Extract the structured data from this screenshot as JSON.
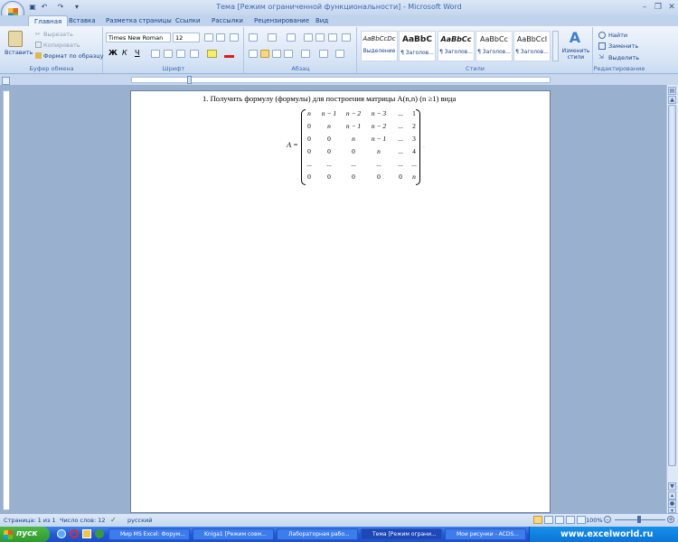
{
  "window": {
    "title": "Тема [Режим ограниченной функциональности] - Microsoft Word",
    "minimize_icon": "minimize-icon",
    "restore_icon": "restore-icon",
    "close_icon": "close-icon"
  },
  "tabs": [
    "Главная",
    "Вставка",
    "Разметка страницы",
    "Ссылки",
    "Рассылки",
    "Рецензирование",
    "Вид"
  ],
  "ribbon": {
    "clipboard": {
      "group": "Буфер обмена",
      "paste": "Вставить",
      "cut": "Вырезать",
      "copy": "Копировать",
      "format_painter": "Формат по образцу"
    },
    "font": {
      "group": "Шрифт",
      "family": "Times New Roman",
      "size": "12",
      "bold": "Ж",
      "italic": "К",
      "underline": "Ч"
    },
    "paragraph": {
      "group": "Абзац"
    },
    "styles": {
      "group": "Стили",
      "items": [
        {
          "preview": "AaBbCcDc",
          "name": "Выделение"
        },
        {
          "preview": "AaBbC",
          "name": "¶ Заголов..."
        },
        {
          "preview": "AaBbCc",
          "name": "¶ Заголов..."
        },
        {
          "preview": "AaBbCc",
          "name": "¶ Заголов..."
        },
        {
          "preview": "AaBbCcI",
          "name": "¶ Заголов..."
        }
      ],
      "change_styles": "Изменить стили"
    },
    "editing": {
      "group": "Редактирование",
      "find": "Найти",
      "replace": "Заменить",
      "select": "Выделить"
    }
  },
  "document": {
    "heading": "1.   Получить формулу (формулы) для построения матрицы A(n,n) (n ≥1) вида",
    "matrix_lhs": "A =",
    "matrix_rows": [
      [
        "n",
        "n − 1",
        "n − 2",
        "n − 3",
        "...",
        "1"
      ],
      [
        "0",
        "n",
        "n − 1",
        "n − 2",
        "...",
        "2"
      ],
      [
        "0",
        "0",
        "n",
        "n − 1",
        "...",
        "3"
      ],
      [
        "0",
        "0",
        "0",
        "n",
        "...",
        "4"
      ],
      [
        "...",
        "...",
        "...",
        "...",
        "...",
        "..."
      ],
      [
        "0",
        "0",
        "0",
        "0",
        "0",
        "n"
      ]
    ]
  },
  "status": {
    "page": "Страница: 1 из 1",
    "words": "Число слов: 12",
    "language": "русский",
    "zoom": "100%"
  },
  "taskbar": {
    "start": "пуск",
    "tasks": [
      "Мир MS Excel: Форум...",
      "Kniga1 [Режим совм...",
      "Лабораторная рабо...",
      "Тема [Режим ограни...",
      "Мои рисунки - ACDS..."
    ],
    "brand": "www.excelworld.ru"
  },
  "colors": {
    "ribbon": "#dfe9f5",
    "taskbar": "#2359d6",
    "page": "#ffffff",
    "workspace": "#9ab0cf"
  }
}
